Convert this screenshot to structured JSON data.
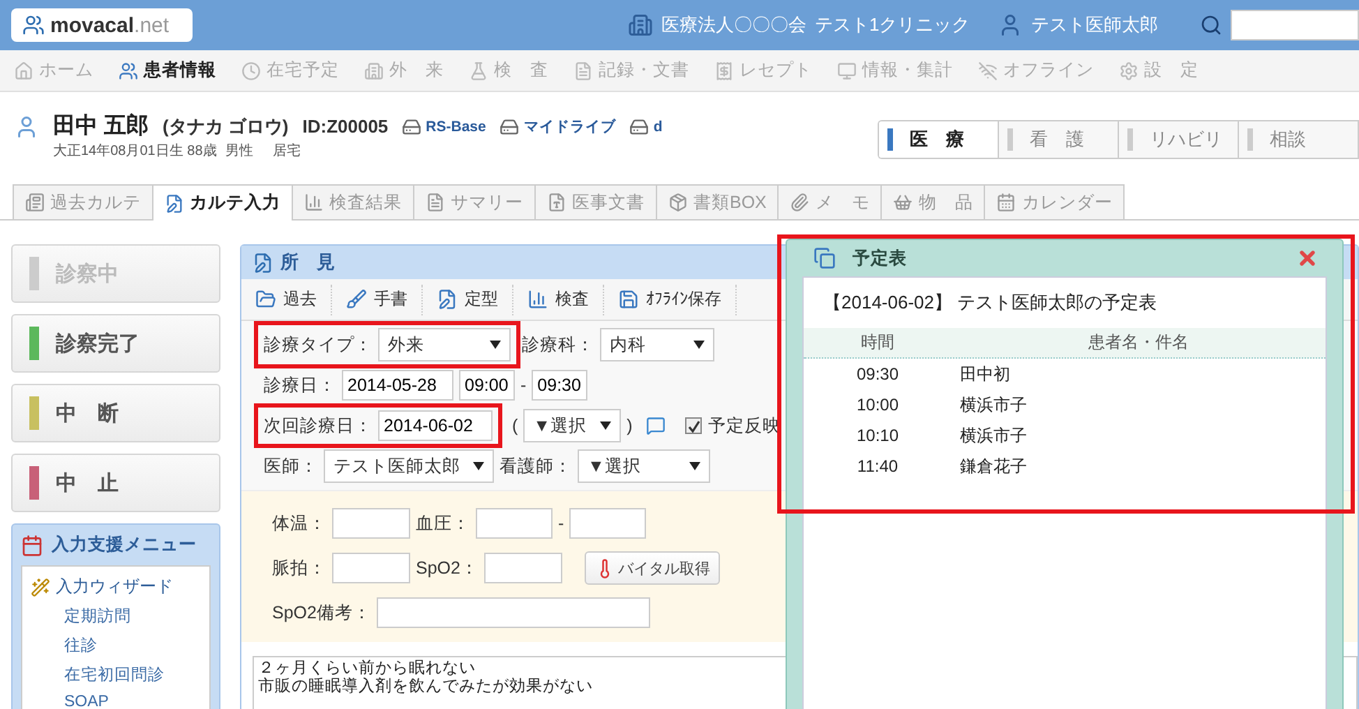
{
  "header": {
    "logo_name": "movacal",
    "logo_suffix": ".net",
    "organization": "医療法人〇〇〇会",
    "clinic": "テスト1クリニック",
    "user": "テスト医師太郎"
  },
  "nav": [
    {
      "label": "ホーム",
      "selected": false
    },
    {
      "label": "患者情報",
      "selected": true
    },
    {
      "label": "在宅予定",
      "selected": false
    },
    {
      "label": "外　来",
      "selected": false
    },
    {
      "label": "検　査",
      "selected": false
    },
    {
      "label": "記録・文書",
      "selected": false
    },
    {
      "label": "レセプト",
      "selected": false
    },
    {
      "label": "情報・集計",
      "selected": false
    },
    {
      "label": "オフライン",
      "selected": false
    },
    {
      "label": "設　定",
      "selected": false
    }
  ],
  "patient": {
    "name": "田中 五郎",
    "kana": "(タナカ ゴロウ)",
    "id": "ID:Z00005",
    "links": [
      "RS-Base",
      "マイドライブ",
      "d"
    ],
    "birth": "大正14年08月01日生 88歳",
    "sex": "男性",
    "residence": "居宅"
  },
  "dept_tabs": [
    {
      "label": "医　療",
      "selected": true
    },
    {
      "label": "看　護",
      "selected": false
    },
    {
      "label": "リハビリ",
      "selected": false
    },
    {
      "label": "相談",
      "selected": false
    }
  ],
  "record_tabs": [
    {
      "label": "過去カルテ",
      "selected": false
    },
    {
      "label": "カルテ入力",
      "selected": true
    },
    {
      "label": "検査結果",
      "selected": false
    },
    {
      "label": "サマリー",
      "selected": false
    },
    {
      "label": "医事文書",
      "selected": false
    },
    {
      "label": "書類BOX",
      "selected": false
    },
    {
      "label": "メ　モ",
      "selected": false
    },
    {
      "label": "物　品",
      "selected": false
    },
    {
      "label": "カレンダー",
      "selected": false
    }
  ],
  "status_buttons": [
    {
      "label": "診察中",
      "color": "#cccccc",
      "disabled": true
    },
    {
      "label": "診察完了",
      "color": "#5cb85c",
      "disabled": false
    },
    {
      "label": "中　断",
      "color": "#c8c060",
      "disabled": false
    },
    {
      "label": "中　止",
      "color": "#c86078",
      "disabled": false
    }
  ],
  "support_menu": {
    "title": "入力支援メニュー",
    "items": [
      {
        "label": "入力ウィザード",
        "children": [
          {
            "label": "定期訪問"
          },
          {
            "label": "往診"
          },
          {
            "label": "在宅初回問診"
          },
          {
            "label": "SOAP"
          }
        ]
      }
    ]
  },
  "form": {
    "title": "所　見",
    "toolbar": [
      "過去",
      "手書",
      "定型",
      "検査",
      "ｵﾌﾗｲﾝ保存"
    ],
    "visit_type": {
      "label": "診療タイプ：",
      "value": "外来",
      "highlighted": true
    },
    "department": {
      "label": "診療科：",
      "value": "内科"
    },
    "visit_date": {
      "label": "診療日：",
      "value": "2014-05-28",
      "start": "09:00",
      "separator": "-",
      "end": "09:30"
    },
    "next_date": {
      "label": "次回診療日：",
      "value": "2014-06-02",
      "highlighted": true,
      "open": "(",
      "select": "▼選択",
      "close": ")",
      "reflect": {
        "label": "予定反映",
        "checked": true
      }
    },
    "doctor": {
      "label": "医師：",
      "value": "テスト医師太郎"
    },
    "nurse": {
      "label": "看護師：",
      "value": "▼選択"
    },
    "vitals": {
      "temperature": "体温：",
      "blood_pressure": "血圧：",
      "bp_separator": "-",
      "pulse": "脈拍：",
      "spo2": "SpO2：",
      "fetch_button": "バイタル取得",
      "spo2_note": "SpO2備考："
    },
    "notes": [
      "２ヶ月くらい前から眠れない",
      "市販の睡眠導入剤を飲んでみたが効果がない"
    ]
  },
  "popup": {
    "title": "予定表",
    "highlighted": true,
    "heading": "【2014-06-02】 テスト医師太郎の予定表",
    "columns": [
      "時間",
      "患者名・件名"
    ],
    "rows": [
      {
        "time": "09:30",
        "name": "田中初"
      },
      {
        "time": "10:00",
        "name": "横浜市子"
      },
      {
        "time": "10:10",
        "name": "横浜市子"
      },
      {
        "time": "11:40",
        "name": "鎌倉花子"
      }
    ]
  }
}
